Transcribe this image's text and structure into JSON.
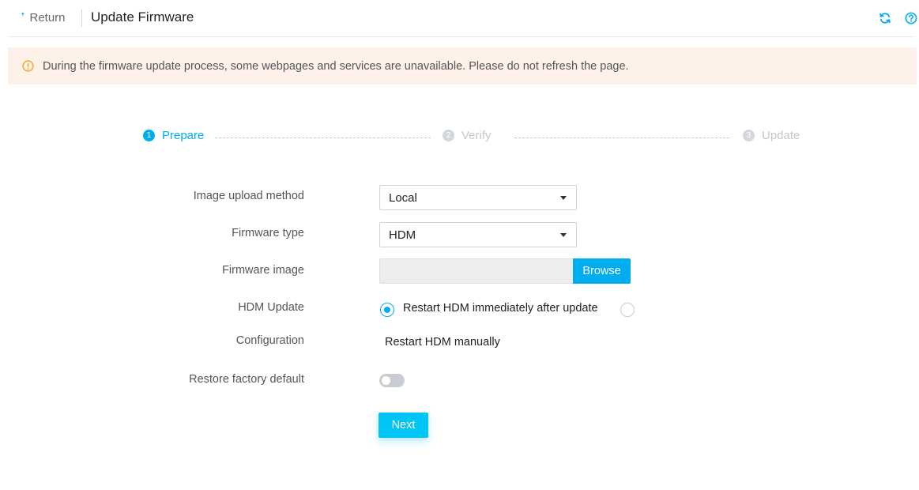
{
  "header": {
    "return_label": "Return",
    "return_arrow": "ꜛ",
    "title": "Update Firmware",
    "icons": [
      "refresh-icon",
      "help-icon"
    ]
  },
  "alert": {
    "text": "During the firmware update process, some webpages and services are unavailable. Please do not refresh the page.",
    "icon": "warning-icon",
    "background": "#fdf1e9",
    "icon_color": "#f5a623"
  },
  "steps": [
    {
      "number": "1",
      "label": "Prepare",
      "state": "active"
    },
    {
      "number": "2",
      "label": "Verify",
      "state": "inactive"
    },
    {
      "number": "3",
      "label": "Update",
      "state": "inactive"
    }
  ],
  "form": {
    "upload_method": {
      "label": "Image upload method",
      "value": "Local"
    },
    "firmware_type": {
      "label": "Firmware type",
      "value": "HDM"
    },
    "firmware_image": {
      "label": "Firmware image",
      "value": "",
      "browse_label": "Browse"
    },
    "hdm_update": {
      "label": "HDM Update",
      "options": [
        {
          "label": "Restart HDM immediately after update",
          "checked": true
        },
        {
          "label": "Restart HDM manually",
          "checked": false
        }
      ]
    },
    "configuration": {
      "label": "Configuration"
    },
    "restore_default": {
      "label": "Restore factory default",
      "enabled": false
    }
  },
  "actions": {
    "next_label": "Next"
  },
  "colors": {
    "accent": "#00aeef",
    "button": "#00c4f3",
    "inactive_step": "#c3c7cc"
  }
}
